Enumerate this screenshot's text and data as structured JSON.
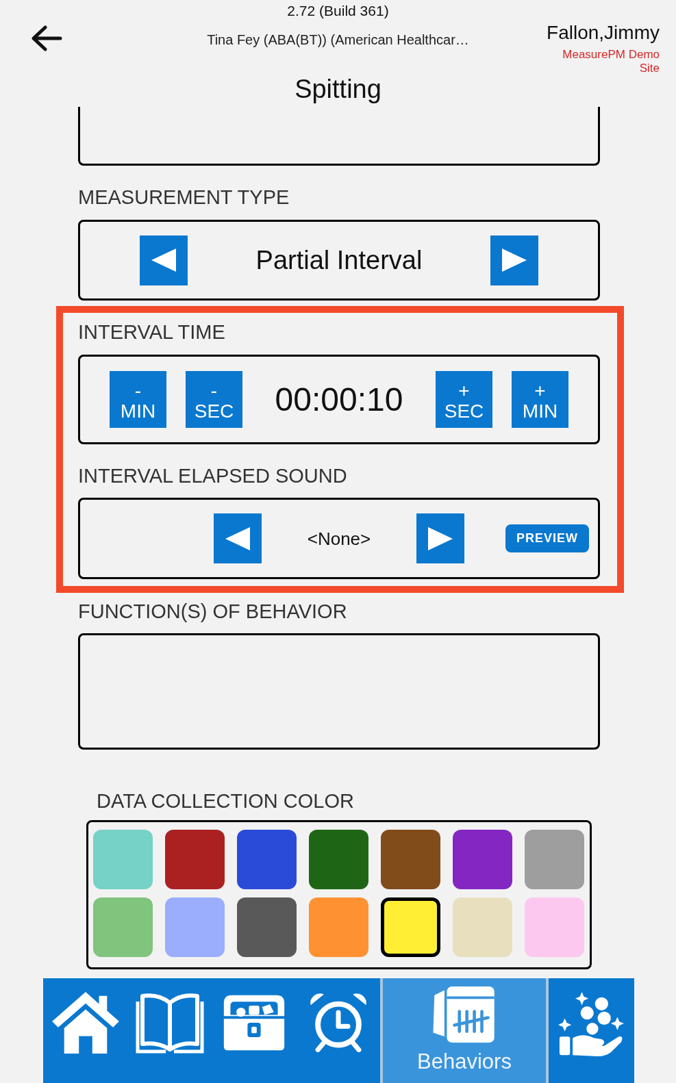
{
  "header": {
    "version": "2.72 (Build 361)",
    "subtitle": "Tina Fey (ABA(BT)) (American Healthcar…",
    "user": "Fallon,Jimmy",
    "site": "MeasurePM Demo Site"
  },
  "title": "Spitting",
  "measurement_type": {
    "label": "MEASUREMENT TYPE",
    "value": "Partial Interval"
  },
  "interval_section": {
    "highlighted": true,
    "interval_time": {
      "label": "INTERVAL TIME",
      "value": "00:00:10",
      "decrease_buttons": [
        {
          "sign": "-",
          "unit": "MIN"
        },
        {
          "sign": "-",
          "unit": "SEC"
        }
      ],
      "increase_buttons": [
        {
          "sign": "+",
          "unit": "SEC"
        },
        {
          "sign": "+",
          "unit": "MIN"
        }
      ]
    },
    "elapsed_sound": {
      "label": "INTERVAL ELAPSED SOUND",
      "value": "<None>",
      "preview_button": "PREVIEW"
    }
  },
  "functions": {
    "label": "FUNCTION(S) OF BEHAVIOR"
  },
  "data_collection_color": {
    "label": "DATA COLLECTION COLOR",
    "swatches": [
      {
        "color": "#76d1c6",
        "selected": false
      },
      {
        "color": "#ab2121",
        "selected": false
      },
      {
        "color": "#2a4bd8",
        "selected": false
      },
      {
        "color": "#1e6615",
        "selected": false
      },
      {
        "color": "#824b1a",
        "selected": false
      },
      {
        "color": "#8427c2",
        "selected": false
      },
      {
        "color": "#9e9e9e",
        "selected": false
      },
      {
        "color": "#80c47d",
        "selected": false
      },
      {
        "color": "#9aaefd",
        "selected": false
      },
      {
        "color": "#595959",
        "selected": false
      },
      {
        "color": "#fe9232",
        "selected": false
      },
      {
        "color": "#ffee33",
        "selected": true
      },
      {
        "color": "#e8dfbe",
        "selected": false
      },
      {
        "color": "#fdc8f0",
        "selected": false
      }
    ]
  },
  "nav": [
    {
      "kind": "home",
      "selected": false
    },
    {
      "kind": "book",
      "selected": false
    },
    {
      "kind": "chest",
      "selected": false
    },
    {
      "kind": "clock",
      "selected": false
    },
    {
      "kind": "behaviors",
      "label": "Behaviors",
      "selected": true
    },
    {
      "kind": "rewards",
      "selected": false
    }
  ]
}
